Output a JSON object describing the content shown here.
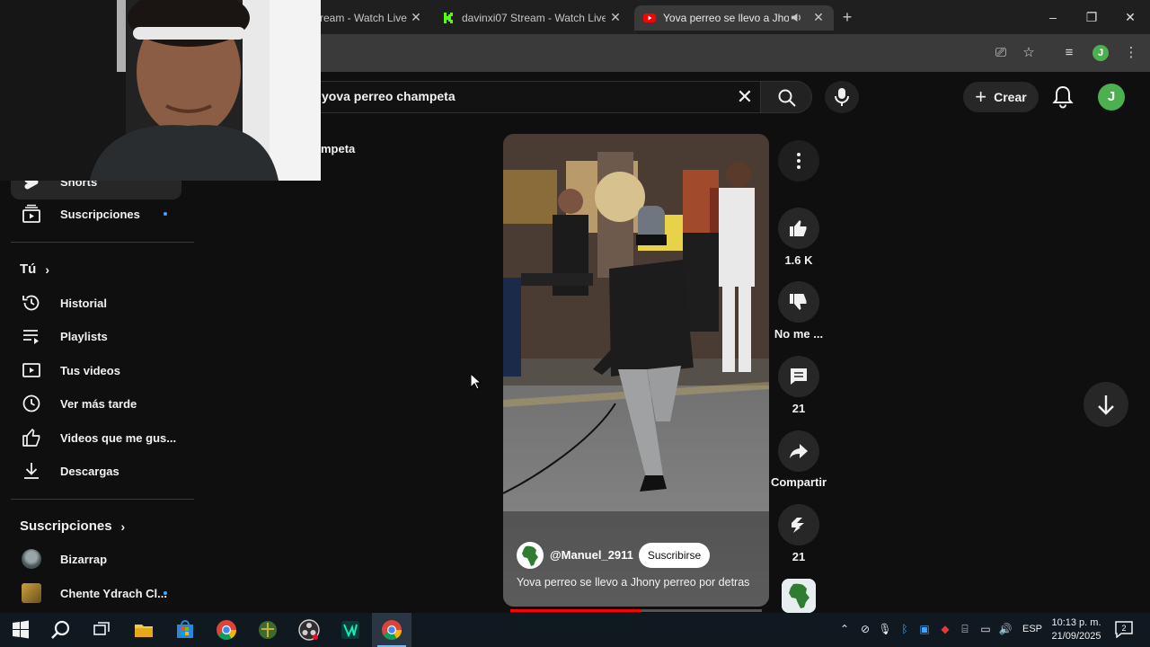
{
  "browser": {
    "tabs": [
      {
        "title": "ream - Watch Live",
        "active": false
      },
      {
        "title": "davinxi07 Stream - Watch Live",
        "active": false
      },
      {
        "title": "Yova perreo se llevo a Jhony",
        "active": true
      }
    ],
    "profile_letter": "J"
  },
  "youtube": {
    "search": {
      "query": "yova perreo champeta"
    },
    "create_label": "Crear",
    "avatar_letter": "J",
    "chip_title": "mpeta"
  },
  "sidebar": {
    "items_top": [
      {
        "label": "Shorts",
        "icon": "shorts-icon"
      },
      {
        "label": "Suscripciones",
        "icon": "subscriptions-icon",
        "dot": true
      }
    ],
    "you_header": "Tú",
    "you_items": [
      {
        "label": "Historial",
        "icon": "history-icon"
      },
      {
        "label": "Playlists",
        "icon": "playlists-icon"
      },
      {
        "label": "Tus videos",
        "icon": "your-videos-icon"
      },
      {
        "label": "Ver más tarde",
        "icon": "watch-later-icon"
      },
      {
        "label": "Videos que me gus...",
        "icon": "liked-icon"
      },
      {
        "label": "Descargas",
        "icon": "downloads-icon"
      }
    ],
    "subs_header": "Suscripciones",
    "subs_items": [
      {
        "label": "Bizarrap"
      },
      {
        "label": "Chente Ydrach Cl...",
        "dot": true
      }
    ]
  },
  "short": {
    "channel": "@Manuel_2911",
    "subscribe_label": "Suscribirse",
    "title": "Yova perreo se llevo a Jhony perreo por detras",
    "progress": 0.52,
    "likes": "1.6 K",
    "dislike_label": "No me ...",
    "comments": "21",
    "share_label": "Compartir",
    "remix_count": "21"
  },
  "taskbar": {
    "language": "ESP",
    "time": "10:13 p. m.",
    "date": "21/09/2025",
    "notifications": "2"
  },
  "colors": {
    "background": "#0f0f0f",
    "accent_red": "#ff0000",
    "avatar_green": "#4caf50",
    "link_blue": "#3ea6ff"
  }
}
